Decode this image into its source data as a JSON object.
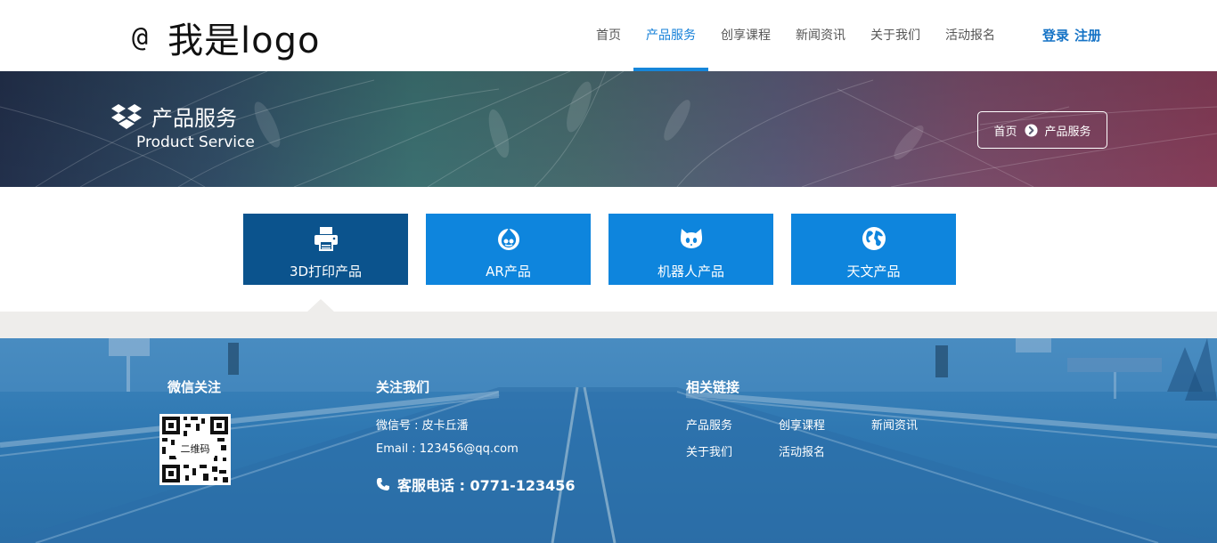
{
  "header": {
    "logo_symbol": "@",
    "logo_text": "我是logo",
    "nav": [
      {
        "label": "首页",
        "active": false
      },
      {
        "label": "产品服务",
        "active": true
      },
      {
        "label": "创享课程",
        "active": false
      },
      {
        "label": "新闻资讯",
        "active": false
      },
      {
        "label": "关于我们",
        "active": false
      },
      {
        "label": "活动报名",
        "active": false
      }
    ],
    "login_label": "登录",
    "register_label": "注册"
  },
  "banner": {
    "icon": "dropbox-icon",
    "title": "产品服务",
    "subtitle": "Product Service",
    "breadcrumb": {
      "home": "首页",
      "separator_icon": "circle-arrow-right-icon",
      "current": "产品服务"
    }
  },
  "products": {
    "tabs": [
      {
        "label": "3D打印产品",
        "icon": "printer-icon",
        "active": true
      },
      {
        "label": "AR产品",
        "icon": "drupal-icon",
        "active": false
      },
      {
        "label": "机器人产品",
        "icon": "github-icon",
        "active": false
      },
      {
        "label": "天文产品",
        "icon": "globe-icon",
        "active": false
      }
    ]
  },
  "footer": {
    "wechat": {
      "heading": "微信关注",
      "qr_label": "二维码"
    },
    "follow": {
      "heading": "关注我们",
      "wechat_id": "微信号 : 皮卡丘潘",
      "email": "Email : 123456@qq.com",
      "phone": "客服电话 : 0771-123456",
      "phone_icon": "phone-icon"
    },
    "links": {
      "heading": "相关链接",
      "items": [
        "产品服务",
        "创享课程",
        "新闻资讯",
        "关于我们",
        "活动报名"
      ]
    }
  },
  "colors": {
    "accent": "#1686d9",
    "tab_blue": "#0e85dd",
    "tab_active": "#0b538d",
    "auth_blue": "#1573c6",
    "footer_blue": "#2f78b2",
    "band_gray": "#eeedeb"
  }
}
